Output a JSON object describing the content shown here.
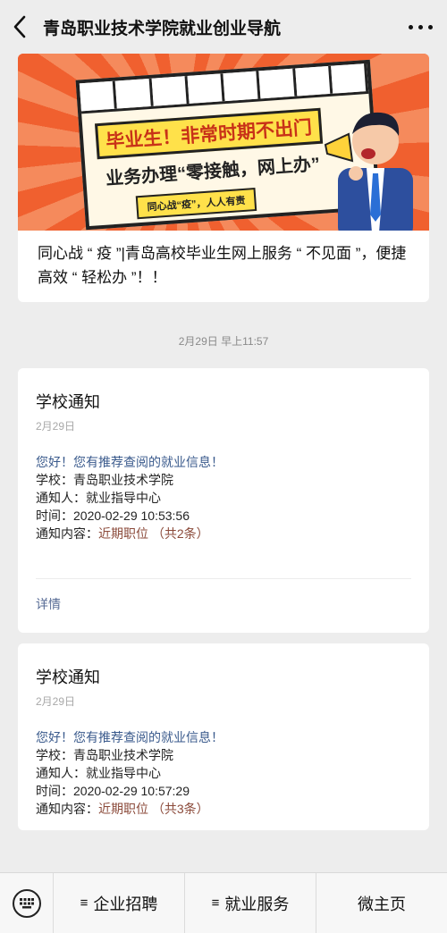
{
  "header": {
    "title": "青岛职业技术学院就业创业导航"
  },
  "article": {
    "banner": {
      "headline": "毕业生！非常时期不出门",
      "subheadline": "业务办理“零接触，网上办”",
      "tag": "同心战“疫”，人人有责"
    },
    "title": "同心战 “ 疫 ”|青岛高校毕业生网上服务 “ 不见面 ”，便捷高效 “ 轻松办 ”！！"
  },
  "timestamp": "2月29日 早上11:57",
  "notices": [
    {
      "title": "学校通知",
      "date": "2月29日",
      "greeting": "您好！您有推荐查阅的就业信息！",
      "school_label": "学校：",
      "school": "青岛职业技术学院",
      "notifier_label": "通知人：",
      "notifier": "就业指导中心",
      "time_label": "时间：",
      "time": "2020-02-29 10:53:56",
      "content_label": "通知内容：",
      "content": "近期职位 （共2条）",
      "detail": "详情"
    },
    {
      "title": "学校通知",
      "date": "2月29日",
      "greeting": "您好！您有推荐查阅的就业信息！",
      "school_label": "学校：",
      "school": "青岛职业技术学院",
      "notifier_label": "通知人：",
      "notifier": "就业指导中心",
      "time_label": "时间：",
      "time": "2020-02-29 10:57:29",
      "content_label": "通知内容：",
      "content": "近期职位 （共3条）"
    }
  ],
  "bottom_menu": {
    "items": [
      {
        "glyph": "≡",
        "label": "企业招聘"
      },
      {
        "glyph": "≡",
        "label": "就业服务"
      },
      {
        "label": "微主页"
      }
    ]
  },
  "colors": {
    "background": "#ededed",
    "link_blue": "#576b95",
    "greeting_blue": "#3a5a8c",
    "content_red": "#8b4a3a",
    "banner_orange": "#f26a3d"
  },
  "icons": [
    "back-arrow-icon",
    "more-dots-icon",
    "keyboard-icon",
    "menu-lines-icon"
  ]
}
